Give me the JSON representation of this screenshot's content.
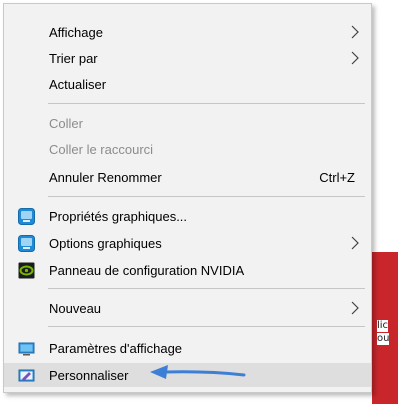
{
  "menu": {
    "items": [
      {
        "label": "Affichage",
        "submenu": true
      },
      {
        "label": "Trier par",
        "submenu": true
      },
      {
        "label": "Actualiser"
      },
      {
        "label": "Coller",
        "disabled": true
      },
      {
        "label": "Coller le raccourci",
        "disabled": true
      },
      {
        "label": "Annuler Renommer",
        "shortcut": "Ctrl+Z"
      },
      {
        "label": "Propriétés graphiques...",
        "icon": "intel-graphics-icon"
      },
      {
        "label": "Options graphiques",
        "icon": "intel-graphics-icon",
        "submenu": true
      },
      {
        "label": "Panneau de configuration NVIDIA",
        "icon": "nvidia-icon"
      },
      {
        "label": "Nouveau",
        "submenu": true
      },
      {
        "label": "Paramètres d'affichage",
        "icon": "display-settings-icon"
      },
      {
        "label": "Personnaliser",
        "icon": "personalize-icon",
        "highlighted": true
      }
    ]
  },
  "background": {
    "text_line_1": "lic",
    "text_line_2": "ou"
  },
  "colors": {
    "menu_bg": "#f2f2f2",
    "highlight": "#dedede",
    "disabled_text": "#8c8c8c",
    "annotation_arrow": "#3d7fd6",
    "background_red": "#c8262b"
  }
}
